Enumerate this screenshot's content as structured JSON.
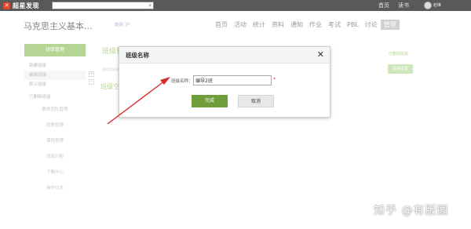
{
  "topbar": {
    "brand": "超星发现",
    "search_placeholder": "",
    "links": [
      "首页",
      "读书"
    ],
    "username": "赵琳"
  },
  "course": {
    "title": "马克思主义基本...",
    "subtitle": "教师门户"
  },
  "nav": {
    "items": [
      "首页",
      "活动",
      "统计",
      "资料",
      "通知",
      "作业",
      "考试",
      "PBL",
      "讨论",
      "管理"
    ],
    "active_index": 9
  },
  "sidebar": {
    "header": "班级管理",
    "items": [
      "新建班级",
      "编辑班级",
      "默认班级",
      "已删除班级"
    ],
    "sub_items": [
      "教师团队管理",
      "助教管理",
      "课程管理",
      "班级分配",
      "下载中心",
      "操作日志"
    ]
  },
  "main": {
    "title": "班级管理",
    "row_text": "送同类班级",
    "row2_text": "班级空",
    "right_link": "已删除班级",
    "right_button": "班级设置"
  },
  "dialog": {
    "title": "班级名称",
    "close_glyph": "✕",
    "field_label": "班级名称：",
    "field_value": "编导2班",
    "required_mark": "*",
    "confirm_label": "完成",
    "cancel_label": "取消"
  },
  "watermark": "知乎 @有版图",
  "colors": {
    "accent_green": "#8dbf5b",
    "confirm_green": "#6e9d3a",
    "arrow_red": "#d82b2b",
    "topbar": "#58595b"
  }
}
